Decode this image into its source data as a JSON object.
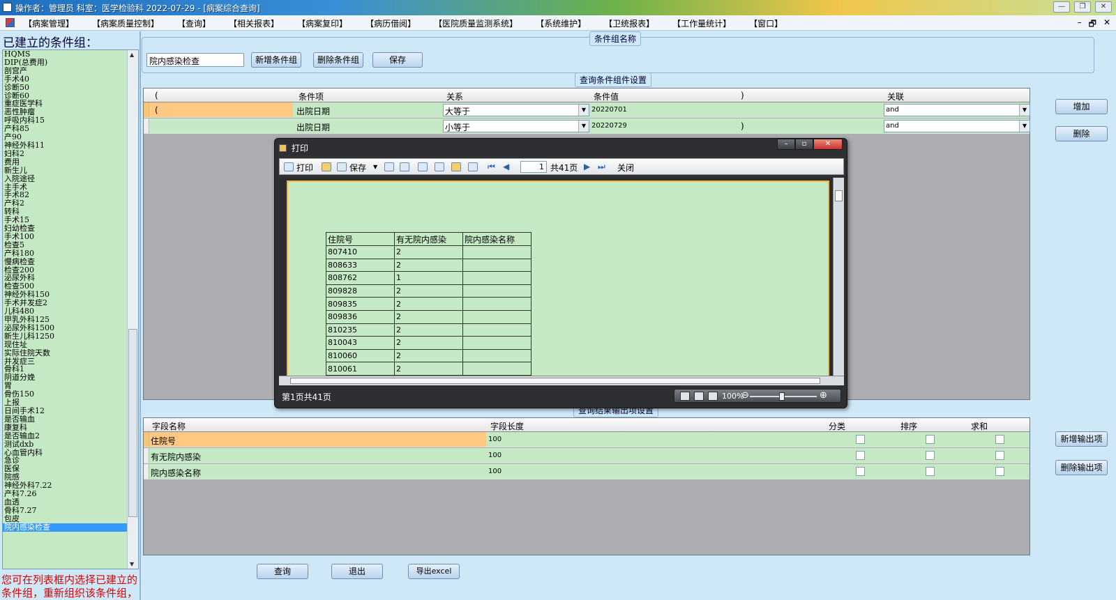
{
  "window": {
    "title": "操作者：管理员  科室：医学检验科  2022-07-29 - [病案综合查询]",
    "controls": [
      "—",
      "❐",
      "✕"
    ]
  },
  "menu": {
    "items": [
      "【病案管理】",
      "【病案质量控制】",
      "【查询】",
      "【相关报表】",
      "【病案复印】",
      "【病历借阅】",
      "【医院质量监测系统】",
      "【系统维护】",
      "【卫统报表】",
      "【工作量统计】",
      "【窗口】"
    ],
    "mdi_controls": [
      "–",
      "🗗",
      "✕"
    ]
  },
  "left_panel": {
    "heading": "已建立的条件组：",
    "groups": [
      "HQMS",
      "DIP(总费用)",
      "剖宫产",
      "手术40",
      "诊断50",
      "诊断60",
      "重症医学科",
      "恶性肿瘤",
      "呼吸内科15",
      "产科85",
      "产90",
      "神经外科11",
      "妇科2",
      "费用",
      "新生儿",
      "入院途径",
      "主手术",
      "手术82",
      "产科2",
      "转科",
      "手术15",
      "妇幼检查",
      "手术100",
      "检查5",
      "产科180",
      "慢病检查",
      "检查200",
      "泌尿外科",
      "检查500",
      "神经外科150",
      "手术并发症2",
      "儿科480",
      "甲乳外科125",
      "泌尿外科1500",
      "新生儿科1250",
      "现住址",
      "实际住院天数",
      "并发症三",
      "骨科1",
      "阴道分娩",
      "胃",
      "骨伤150",
      "上报",
      "日间手术12",
      "是否输血",
      "康复科",
      "是否输血2",
      "测试dxb",
      "心血管内科",
      "急诊",
      "医保",
      "院感",
      "神经外科7.22",
      "产科7.26",
      "血透",
      "骨科7.27",
      "包皮",
      "院内感染检查"
    ],
    "selected": "院内感染检查",
    "help": "您可在列表框内选择已建立的条件组，重新组织该条件组，或者直接进行查询工作。"
  },
  "group_name": {
    "section_title": "条件组名称",
    "value": "院内感染检查",
    "new_button": "新增条件组",
    "delete_button": "删除条件组",
    "save_button": "保存"
  },
  "conditions": {
    "section_title": "查询条件组件设置",
    "headers": [
      "(",
      "条件项",
      "关系",
      "条件值",
      ")",
      "关联"
    ],
    "rows": [
      {
        "open": "(",
        "item": "出院日期",
        "relation": "大等于",
        "value": "20220701",
        "close": "",
        "link": "and"
      },
      {
        "open": "",
        "item": "出院日期",
        "relation": "小等于",
        "value": "20220729",
        "close": ")",
        "link": "and"
      }
    ],
    "add_button": "增加",
    "delete_button": "删除"
  },
  "output": {
    "section_title": "查询结果输出项设置",
    "headers": [
      "字段名称",
      "字段长度",
      "分类",
      "排序",
      "求和"
    ],
    "rows": [
      {
        "name": "住院号",
        "length": "100"
      },
      {
        "name": "有无院内感染",
        "length": "100"
      },
      {
        "name": "院内感染名称",
        "length": "100"
      }
    ],
    "new_button": "新增输出项",
    "delete_button": "删除输出项"
  },
  "bottom_buttons": {
    "query": "查询",
    "exit": "退出",
    "export": "导出excel"
  },
  "print_dialog": {
    "title": "打印",
    "toolbar": {
      "print": "打印",
      "save": "保存",
      "page": "1",
      "total": "共41页",
      "close": "关闭"
    },
    "table_headers": [
      "住院号",
      "有无院内感染",
      "院内感染名称"
    ],
    "table_rows": [
      [
        "807410",
        "2",
        ""
      ],
      [
        "808633",
        "2",
        ""
      ],
      [
        "808762",
        "1",
        ""
      ],
      [
        "809828",
        "2",
        ""
      ],
      [
        "809835",
        "2",
        ""
      ],
      [
        "809836",
        "2",
        ""
      ],
      [
        "810235",
        "2",
        ""
      ],
      [
        "810043",
        "2",
        ""
      ],
      [
        "810060",
        "2",
        ""
      ],
      [
        "810061",
        "2",
        ""
      ]
    ],
    "status": "第1页共41页",
    "zoom": "100%"
  }
}
